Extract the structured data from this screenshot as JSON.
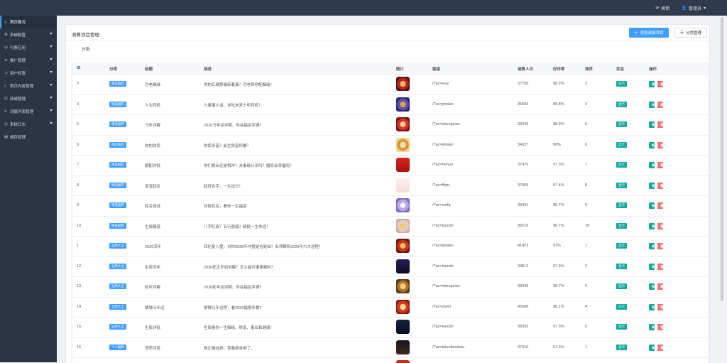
{
  "topbar": {
    "refresh_label": "刷新",
    "user_label": "管理员",
    "refresh_icon": "refresh-icon",
    "user_icon": "user-icon"
  },
  "sidebar": {
    "items": [
      {
        "label": "首页概况",
        "icon": "home-icon",
        "has_children": false
      },
      {
        "label": "系统配置",
        "icon": "gear-icon",
        "has_children": true
      },
      {
        "label": "付费应用",
        "icon": "app-icon",
        "has_children": true
      },
      {
        "label": "推广管理",
        "icon": "share-icon",
        "has_children": true
      },
      {
        "label": "用户权限",
        "icon": "user-icon",
        "has_children": true
      },
      {
        "label": "首页内容管理",
        "icon": "home-icon",
        "has_children": true
      },
      {
        "label": "商城管理",
        "icon": "cart-icon",
        "has_children": true
      },
      {
        "label": "测算列表管理",
        "icon": "list-icon",
        "has_children": true
      },
      {
        "label": "系统日志",
        "icon": "log-icon",
        "has_children": true
      },
      {
        "label": "缓存管理",
        "icon": "trash-icon",
        "has_children": false
      }
    ]
  },
  "panel": {
    "title": "测算项目管理",
    "add_button": "添加测算项目",
    "category_button": "分类管理",
    "filter_label": "分类:"
  },
  "table": {
    "columns": [
      "ID",
      "分类",
      "标题",
      "描述",
      "图片",
      "链接",
      "测算人次",
      "好评率",
      "排序",
      "状态",
      "操作"
    ],
    "edit_label": "编辑",
    "delete_label": "删除",
    "rows": [
      {
        "id": "3",
        "category": "精选推荐",
        "cat_color": "blue",
        "title": "月老姻缘",
        "desc": "你的红绳那端牵着谁？月老帮你配姻缘！",
        "thumb": "t1",
        "link": "/?ac=lozy",
        "count": "37750",
        "rate": "98.2%",
        "sort": "3",
        "status": "显示"
      },
      {
        "id": "4",
        "category": "精选推荐",
        "cat_color": "blue",
        "title": "人生转机",
        "desc": "九紫离火运，详批未来十年转机！",
        "thumb": "t2",
        "link": "/?ac=jinnian",
        "count": "36594",
        "rate": "98.8%",
        "sort": "4",
        "status": "显示"
      },
      {
        "id": "5",
        "category": "精选推荐",
        "cat_color": "blue",
        "title": "马年详解",
        "desc": "2026马年运详解，你会福运亨通?",
        "thumb": "t3",
        "link": "/?ac=shengxiao",
        "count": "33249",
        "rate": "98.9%",
        "sort": "5",
        "status": "显示"
      },
      {
        "id": "6",
        "category": "精选推荐",
        "cat_color": "blue",
        "title": "你的财库",
        "desc": "财库多富？此生财富积累？",
        "thumb": "t4",
        "link": "/?ac=jinnian",
        "count": "34027",
        "rate": "98%",
        "sort": "6",
        "status": "显示"
      },
      {
        "id": "7",
        "category": "精选推荐",
        "cat_color": "blue",
        "title": "婚配详批",
        "desc": "你们相合还是相冲？夫妻缘分深吗？婚后会幸福吗？",
        "thumb": "t5",
        "link": "/?ac=hehun",
        "count": "37475",
        "rate": "97.3%",
        "sort": "7",
        "status": "显示"
      },
      {
        "id": "8",
        "category": "精选推荐",
        "cat_color": "blue",
        "title": "宝宝起名",
        "desc": "起好名字，一生加分！",
        "thumb": "t6",
        "link": "/?ac=ffqm",
        "count": "37809",
        "rate": "97.4%",
        "sort": "8",
        "status": "显示"
      },
      {
        "id": "9",
        "category": "精选推荐",
        "cat_color": "blue",
        "title": "姓名测试",
        "desc": "详批姓名，看你一生福运",
        "thumb": "t7",
        "link": "/?ac=xmfq",
        "count": "39431",
        "rate": "98.7%",
        "sort": "9",
        "status": "显示"
      },
      {
        "id": "10",
        "category": "精选推荐",
        "cat_color": "blue",
        "title": "生辰解惑",
        "desc": "八字旺衰？五行强弱？精批一生命运！",
        "thumb": "t8",
        "link": "/?ac=bazizh",
        "count": "39216",
        "rate": "96.7%",
        "sort": "10",
        "status": "显示"
      },
      {
        "id": "1",
        "category": "运势大全",
        "cat_color": "blue",
        "title": "2026流年",
        "desc": "四化星入盘，对你2026年冲盘是吉是凶？名师解析2026年六大运程！",
        "thumb": "t9",
        "link": "/?ac=jinnian",
        "count": "41473",
        "rate": "97%",
        "sort": "1",
        "status": "显示"
      },
      {
        "id": "12",
        "category": "运势大全",
        "cat_color": "blue",
        "title": "生辰流年",
        "desc": "2026犯太岁如何解？怎么能可事事顺利？",
        "thumb": "t10",
        "link": "/?ac=bazizh",
        "count": "34612",
        "rate": "97.9%",
        "sort": "2",
        "status": "显示"
      },
      {
        "id": "13",
        "category": "运势大全",
        "cat_color": "blue",
        "title": "蛇年详解",
        "desc": "2026蛇年运详解，你会福运亨通?",
        "thumb": "t11",
        "link": "/?ac=shengxiao",
        "count": "33249",
        "rate": "98.7%",
        "sort": "3",
        "status": "显示"
      },
      {
        "id": "14",
        "category": "运势大全",
        "cat_color": "blue",
        "title": "紫微马年运",
        "desc": "紫微马年运程，看2026福祸多寡?",
        "thumb": "t12",
        "link": "/?ac=ziwei",
        "count": "43368",
        "rate": "98.1%",
        "sort": "4",
        "status": "显示"
      },
      {
        "id": "15",
        "category": "运势大全",
        "cat_color": "blue",
        "title": "生辰详批",
        "desc": "生辰看你一生姻缘、财富、事业和健康！",
        "thumb": "t13",
        "link": "/?ac=bazizh",
        "count": "38392",
        "rate": "97.3%",
        "sort": "5",
        "status": "显示"
      },
      {
        "id": "16",
        "category": "个人姻缘",
        "cat_color": "blue",
        "title": "塔罗问答",
        "desc": "做正确选择，答案简单明了。",
        "thumb": "t14",
        "link": "/?ac=taluofenshou",
        "count": "37310",
        "rate": "97.3%",
        "sort": "1",
        "status": "显示"
      },
      {
        "id": "17",
        "category": "个人姻缘",
        "cat_color": "blue",
        "title": "预见正缘",
        "desc": "你的正缘会来？TA出现了吗？姓名详批你的缘定对象！",
        "thumb": "t15",
        "link": "/?ac=hehun",
        "count": "41446",
        "rate": "99%",
        "sort": "2",
        "status": "显示"
      }
    ]
  },
  "colors": {
    "primary": "#409eff",
    "success": "#13a89e",
    "danger": "#f56c6c",
    "sidebar": "#2b3543",
    "topbar": "#2f3b4c"
  }
}
